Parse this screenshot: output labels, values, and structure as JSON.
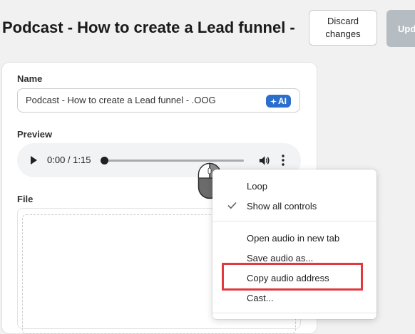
{
  "header": {
    "title": "Podcast - How to create a Lead funnel -",
    "discard_label": "Discard\nchanges",
    "update_label": "Upd"
  },
  "form": {
    "name_label": "Name",
    "name_value": "Podcast - How to create a Lead funnel - .OOG",
    "ai_label": "AI",
    "preview_label": "Preview",
    "file_label": "File"
  },
  "player": {
    "time": "0:00 / 1:15",
    "progress": 0
  },
  "context_menu": {
    "items": [
      {
        "label": "Loop",
        "checked": false
      },
      {
        "label": "Show all controls",
        "checked": true
      },
      {
        "label": "Open audio in new tab",
        "checked": false
      },
      {
        "label": "Save audio as...",
        "checked": false
      },
      {
        "label": "Copy audio address",
        "checked": false,
        "highlighted": true
      },
      {
        "label": "Cast...",
        "checked": false
      }
    ]
  },
  "colors": {
    "accent": "#2c6ecb",
    "highlight": "#e0393e",
    "update_disabled": "#b5bcc2"
  },
  "icons": [
    "play-icon",
    "volume-icon",
    "more-vert-icon",
    "checkmark-icon",
    "mouse-icon",
    "sparkle-icon"
  ]
}
